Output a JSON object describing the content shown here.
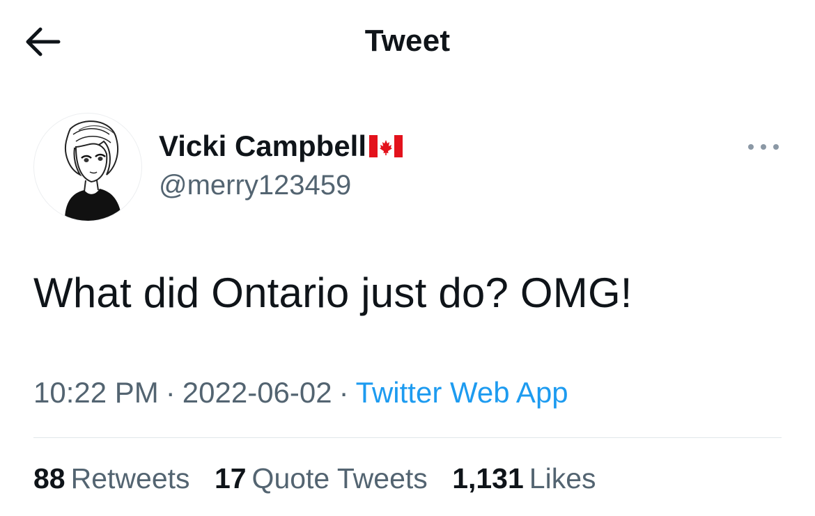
{
  "header": {
    "title": "Tweet",
    "back_icon": "arrow-left-icon"
  },
  "author": {
    "display_name": "Vicki Campbell",
    "flag_icon": "canada-flag-icon",
    "handle": "@merry123459",
    "avatar_icon": "cartoon-avatar-icon"
  },
  "more_icon": "more-horizontal-icon",
  "tweet": {
    "text": "What did Ontario just do? OMG!"
  },
  "meta": {
    "time": "10:22 PM",
    "separator": "·",
    "date": "2022-06-02",
    "source": "Twitter Web App"
  },
  "stats": [
    {
      "count": "88",
      "label": "Retweets"
    },
    {
      "count": "17",
      "label": "Quote Tweets"
    },
    {
      "count": "1,131",
      "label": "Likes"
    }
  ],
  "colors": {
    "text": "#0f1419",
    "secondary": "#536471",
    "link": "#1d9bf0",
    "divider": "#e1e6ea",
    "flag_red": "#e3121c"
  }
}
